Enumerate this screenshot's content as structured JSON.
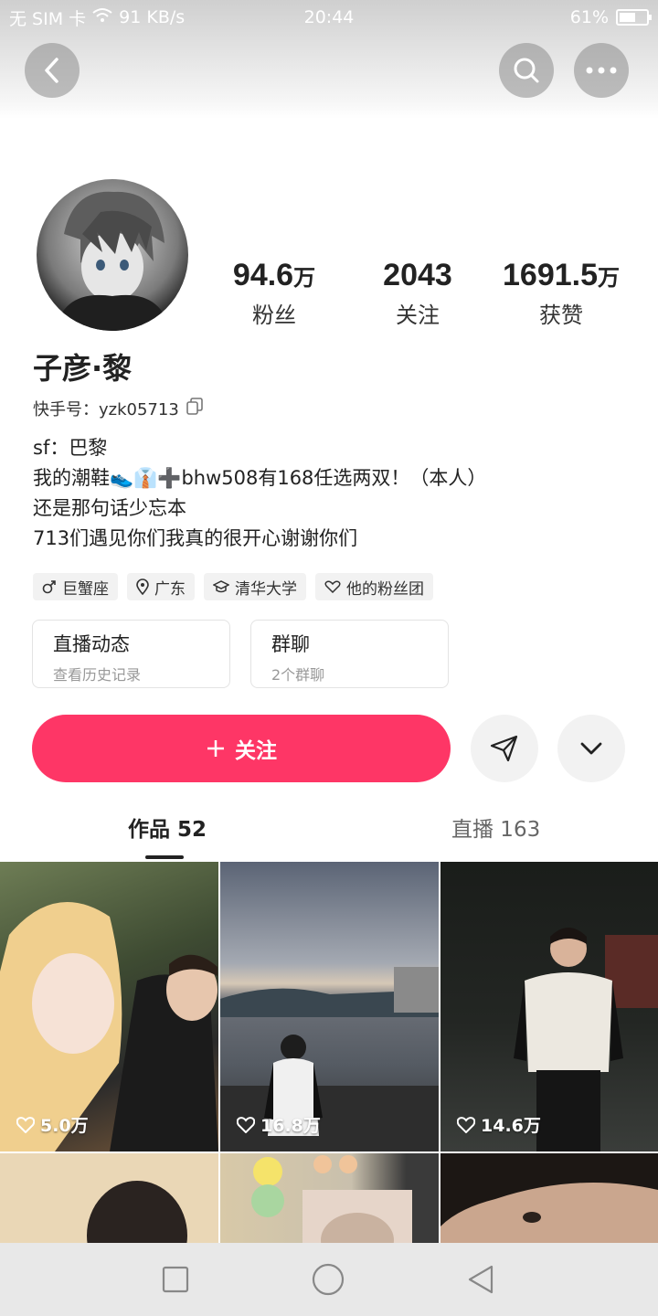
{
  "status_bar": {
    "left": "无 SIM 卡",
    "speed": "91 KB/s",
    "time": "20:44",
    "battery": "61%",
    "battery_level": 0.61
  },
  "profile": {
    "name": "子彦·黎",
    "uid": "快手号：yzk05713",
    "bio": [
      "sf：巴黎",
      "我的潮鞋👟👔➕bhw508有168任选两双！（本人）",
      "还是那句话少忘本",
      "713们遇见你们我真的很开心谢谢你们"
    ],
    "stats": [
      {
        "num": "94.6",
        "unit": "万",
        "label": "粉丝"
      },
      {
        "num": "2043",
        "unit": "",
        "label": "关注"
      },
      {
        "num": "1691.5",
        "unit": "万",
        "label": "获赞"
      }
    ],
    "tags": [
      {
        "icon": "male-icon",
        "label": "巨蟹座"
      },
      {
        "icon": "location-icon",
        "label": "广东"
      },
      {
        "icon": "graduation-cap-icon",
        "label": "清华大学"
      },
      {
        "icon": "fan-club-icon",
        "label": "他的粉丝团"
      }
    ],
    "cards": [
      {
        "title": "直播动态",
        "subtitle": "查看历史记录"
      },
      {
        "title": "群聊",
        "subtitle": "2个群聊"
      }
    ]
  },
  "actions": {
    "follow_label": "关注"
  },
  "tabs": [
    {
      "label": "作品 52",
      "active": true
    },
    {
      "label": "直播 163",
      "active": false
    }
  ],
  "posts": [
    {
      "likes": "5.0万"
    },
    {
      "likes": "16.8万"
    },
    {
      "likes": "14.6万"
    },
    {
      "likes": ""
    },
    {
      "likes": ""
    },
    {
      "likes": ""
    }
  ],
  "colors": {
    "accent": "#fe3666"
  }
}
